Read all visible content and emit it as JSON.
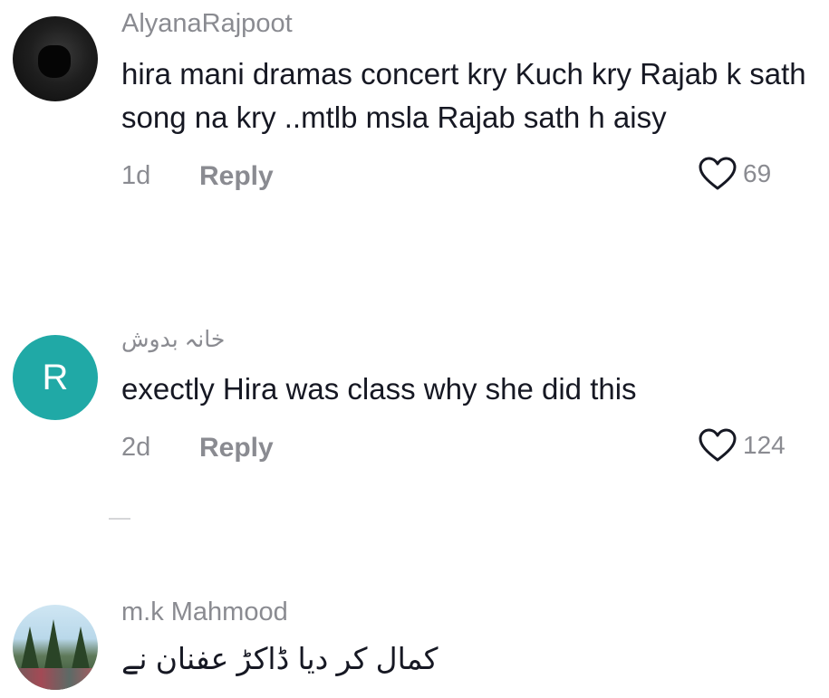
{
  "comments": [
    {
      "username": "AlyanaRajpoot",
      "text": "hira mani dramas concert kry Kuch kry Rajab k sath song na kry ..mtlb msla Rajab sath h aisy",
      "time": "1d",
      "reply_label": "Reply",
      "likes": "69",
      "avatar_icon": "masked-person-avatar"
    },
    {
      "username": "خانہ بدوش",
      "avatar_letter": "R",
      "avatar_color": "#20a9a6",
      "text": "exectly Hira was class why she did this",
      "time": "2d",
      "reply_label": "Reply",
      "likes": "124"
    },
    {
      "username": "m.k Mahmood",
      "text": "کمال کر دیا ڈاکڑ عفنان نے",
      "avatar_icon": "landscape-photo-avatar"
    }
  ],
  "like_icon": "heart-outline-icon",
  "colors": {
    "primary_text": "#161823",
    "secondary_text": "#8a8b91",
    "avatar_teal": "#20a9a6"
  }
}
